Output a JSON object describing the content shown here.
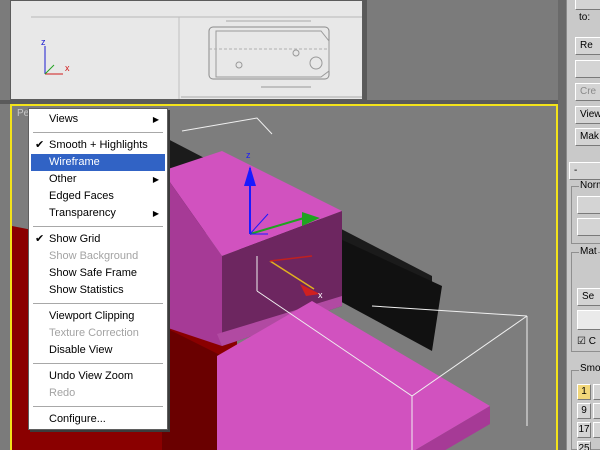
{
  "viewport_label": "Pe",
  "axis_labels": {
    "z": "z",
    "x": "x"
  },
  "menu": {
    "groups": [
      [
        {
          "label": "Views",
          "checked": false,
          "submenu": true,
          "enabled": true,
          "highlighted": false
        }
      ],
      [
        {
          "label": "Smooth + Highlights",
          "checked": true,
          "submenu": false,
          "enabled": true,
          "highlighted": false
        },
        {
          "label": "Wireframe",
          "checked": false,
          "submenu": false,
          "enabled": true,
          "highlighted": true
        },
        {
          "label": "Other",
          "checked": false,
          "submenu": true,
          "enabled": true,
          "highlighted": false
        },
        {
          "label": "Edged Faces",
          "checked": false,
          "submenu": false,
          "enabled": true,
          "highlighted": false
        },
        {
          "label": "Transparency",
          "checked": false,
          "submenu": true,
          "enabled": true,
          "highlighted": false
        }
      ],
      [
        {
          "label": "Show Grid",
          "checked": true,
          "submenu": false,
          "enabled": true,
          "highlighted": false
        },
        {
          "label": "Show Background",
          "checked": false,
          "submenu": false,
          "enabled": false,
          "highlighted": false
        },
        {
          "label": "Show Safe Frame",
          "checked": false,
          "submenu": false,
          "enabled": true,
          "highlighted": false
        },
        {
          "label": "Show Statistics",
          "checked": false,
          "submenu": false,
          "enabled": true,
          "highlighted": false
        }
      ],
      [
        {
          "label": "Viewport Clipping",
          "checked": false,
          "submenu": false,
          "enabled": true,
          "highlighted": false
        },
        {
          "label": "Texture Correction",
          "checked": false,
          "submenu": false,
          "enabled": false,
          "highlighted": false
        },
        {
          "label": "Disable View",
          "checked": false,
          "submenu": false,
          "enabled": true,
          "highlighted": false
        }
      ],
      [
        {
          "label": "Undo View Zoom",
          "checked": false,
          "submenu": false,
          "enabled": true,
          "highlighted": false
        },
        {
          "label": "Redo",
          "checked": false,
          "submenu": false,
          "enabled": false,
          "highlighted": false
        }
      ],
      [
        {
          "label": "Configure...",
          "checked": false,
          "submenu": false,
          "enabled": true,
          "highlighted": false
        }
      ]
    ]
  },
  "command_panel": {
    "to_label": "to:",
    "buttons": [
      "Re",
      "Cre",
      "View",
      "Mak"
    ],
    "rollout_collapse": "-",
    "groups": [
      "Norm",
      "Mat",
      "Smo"
    ],
    "select_button": "Se",
    "checkbox_label": "C",
    "smoothing_numbers": [
      "1",
      "9",
      "17",
      "25"
    ]
  },
  "colors": {
    "viewport_border_active": "#f3e31a",
    "menu_highlight": "#3163c5",
    "object_magenta": "#c94fb6",
    "object_red": "#8a0000"
  },
  "icons": {
    "check": "✔",
    "submenu": "▶"
  }
}
